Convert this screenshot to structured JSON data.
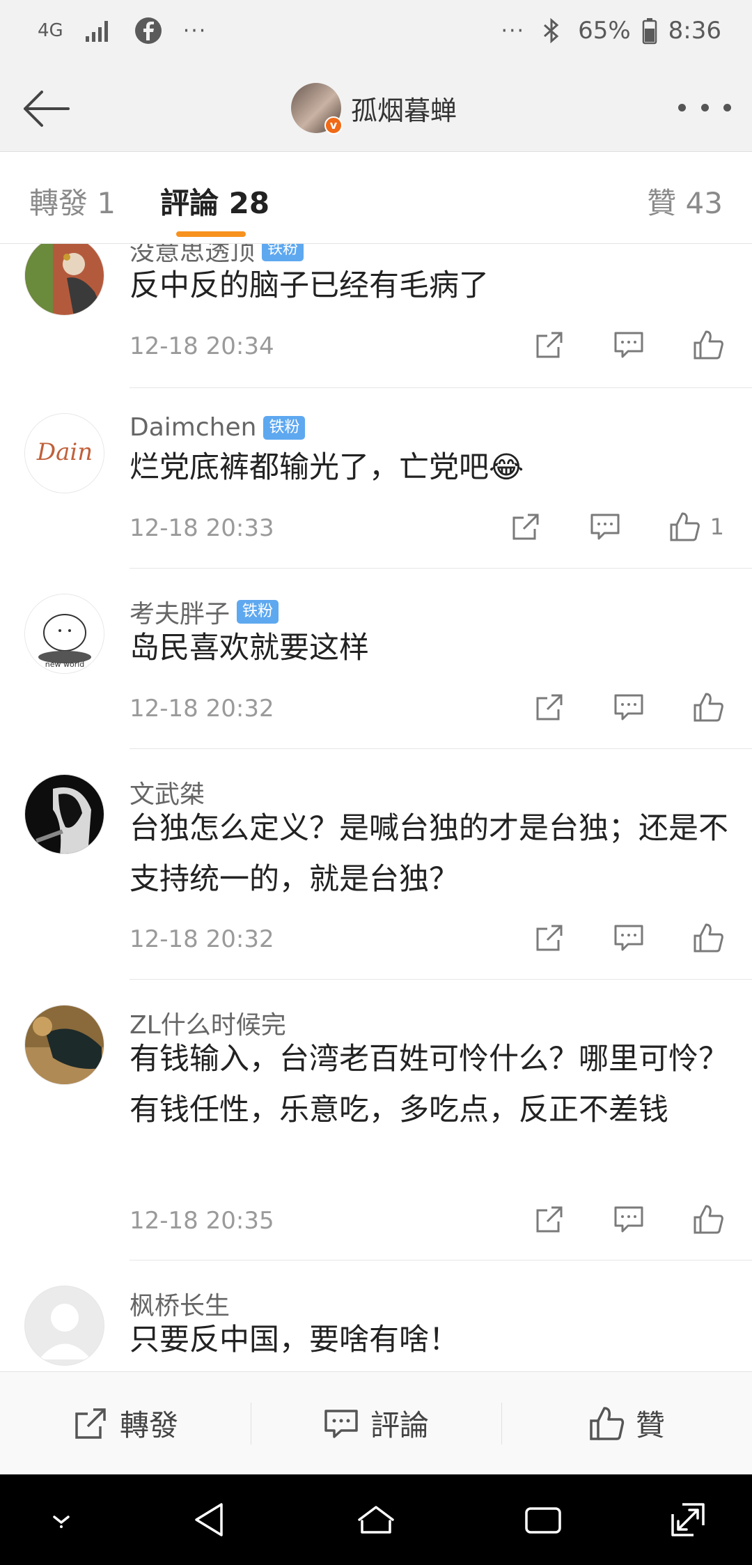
{
  "status_bar": {
    "network": "4G",
    "left_dots": "···",
    "right_dots": "···",
    "battery": "65%",
    "time": "8:36",
    "icons": [
      "signal-icon",
      "facebook-icon",
      "bluetooth-icon",
      "battery-icon"
    ]
  },
  "header": {
    "username": "孤烟暮蝉",
    "verified_badge": "v"
  },
  "tabs": [
    {
      "label": "轉發 1"
    },
    {
      "label": "評論 28"
    },
    {
      "label": "贊 43"
    }
  ],
  "comments": [
    {
      "name": "没意思透顶",
      "badge": "铁粉",
      "text": "反中反的脑子已经有毛病了",
      "time": "12-18 20:34",
      "likes": ""
    },
    {
      "name": "Daimchen",
      "badge": "铁粉",
      "text": "烂党底裤都输光了，亡党吧😂",
      "time": "12-18 20:33",
      "likes": "1",
      "avatar_text": "Dain"
    },
    {
      "name": "考夫胖子",
      "badge": "铁粉",
      "text": "岛民喜欢就要这样",
      "time": "12-18 20:32",
      "likes": "",
      "avatar_text": "new world"
    },
    {
      "name": "文武桀",
      "badge": "",
      "text": "台独怎么定义？是喊台独的才是台独；还是不支持统一的，就是台独？",
      "time": "12-18 20:32",
      "likes": ""
    },
    {
      "name": "ZL什么时候完",
      "badge": "",
      "text": "有钱输入，台湾老百姓可怜什么？哪里可怜？有钱任性，乐意吃，多吃点，反正不差钱",
      "time": "12-18 20:35",
      "likes": ""
    },
    {
      "name": "枫桥长生",
      "badge": "",
      "text": "只要反中国，要啥有啥！",
      "time": "",
      "likes": ""
    }
  ],
  "toolbar": {
    "repost": "轉發",
    "comment": "評論",
    "like": "贊"
  },
  "colors": {
    "accent": "#f7921e",
    "badge": "#5ea8f0",
    "verified": "#f06a17"
  }
}
